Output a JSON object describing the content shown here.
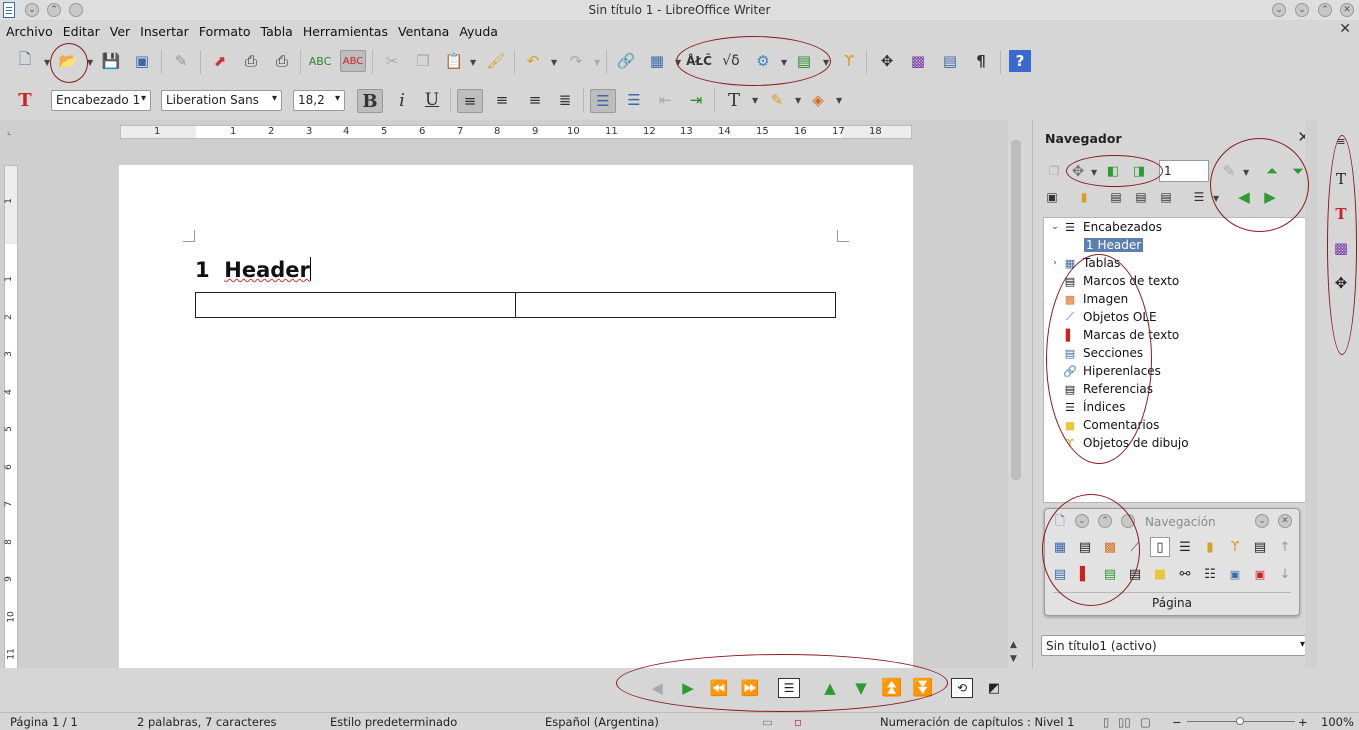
{
  "window": {
    "title": "Sin título 1 - LibreOffice Writer"
  },
  "menu": {
    "items": [
      "Archivo",
      "Editar",
      "Ver",
      "Insertar",
      "Formato",
      "Tabla",
      "Herramientas",
      "Ventana",
      "Ayuda"
    ]
  },
  "format_toolbar": {
    "paragraph_style": "Encabezado 1",
    "font_name": "Liberation Sans",
    "font_size": "18,2"
  },
  "ruler": {
    "h_ticks": [
      "1",
      "1",
      "2",
      "3",
      "4",
      "5",
      "6",
      "7",
      "8",
      "9",
      "10",
      "11",
      "12",
      "13",
      "14",
      "15",
      "16",
      "17",
      "18"
    ],
    "v_ticks": [
      "1",
      "1",
      "2",
      "3",
      "4",
      "5",
      "6",
      "7",
      "8",
      "9",
      "10",
      "11"
    ]
  },
  "document": {
    "heading_number": "1",
    "heading_text": "Header",
    "table": {
      "rows": 1,
      "cols": 2
    }
  },
  "navigator": {
    "title": "Navegador",
    "spin_value": "1",
    "tree": [
      {
        "label": "Encabezados",
        "icon": "headings-icon",
        "expanded": true
      },
      {
        "label": "1 Header",
        "child": true,
        "selected": true
      },
      {
        "label": "Tablas",
        "icon": "table-icon",
        "expandable": true
      },
      {
        "label": "Marcos de texto",
        "icon": "text-frame-icon"
      },
      {
        "label": "Imagen",
        "icon": "image-icon"
      },
      {
        "label": "Objetos OLE",
        "icon": "ole-object-icon"
      },
      {
        "label": "Marcas de texto",
        "icon": "bookmark-icon"
      },
      {
        "label": "Secciones",
        "icon": "sections-icon"
      },
      {
        "label": "Hiperenlaces",
        "icon": "hyperlink-icon"
      },
      {
        "label": "Referencias",
        "icon": "references-icon"
      },
      {
        "label": "Índices",
        "icon": "indexes-icon"
      },
      {
        "label": "Comentarios",
        "icon": "comments-icon"
      },
      {
        "label": "Objetos de dibujo",
        "icon": "drawing-objects-icon"
      }
    ],
    "document_select": "Sin título1 (activo)"
  },
  "navigation_toolbar": {
    "title": "Navegación",
    "label": "Página"
  },
  "status": {
    "page": "Página 1 / 1",
    "words": "2 palabras, 7 caracteres",
    "page_style": "Estilo predeterminado",
    "language": "Español (Argentina)",
    "outline": "Numeración de capítulos : Nivel 1",
    "zoom": "100%"
  },
  "colors": {
    "annotation": "#8b1a1a",
    "selection": "#5a7fb0",
    "nav_green": "#2e9b2e"
  }
}
